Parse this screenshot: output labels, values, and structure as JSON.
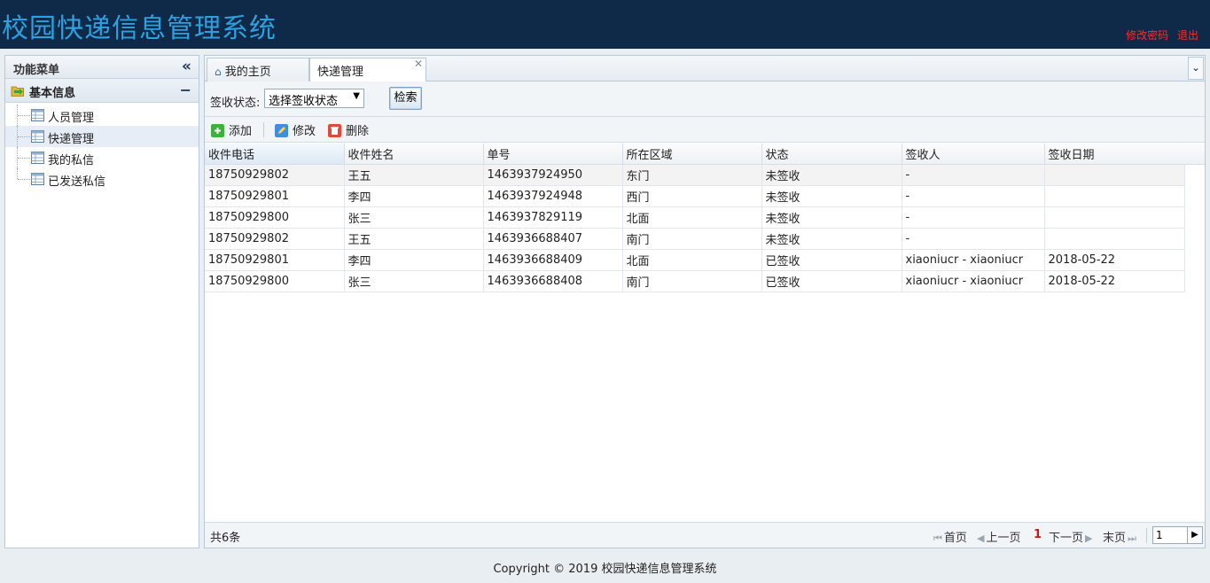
{
  "header": {
    "title": "校园快递信息管理系统",
    "change_password": "修改密码",
    "logout": "退出"
  },
  "sidebar": {
    "title": "功能菜单",
    "group": "基本信息",
    "items": [
      {
        "label": "人员管理"
      },
      {
        "label": "快递管理"
      },
      {
        "label": "我的私信"
      },
      {
        "label": "已发送私信"
      }
    ]
  },
  "tabs": [
    {
      "label": "我的主页"
    },
    {
      "label": "快递管理"
    }
  ],
  "search": {
    "label": "签收状态:",
    "select_value": "选择签收状态",
    "button": "检索"
  },
  "toolbar": {
    "add": "添加",
    "edit": "修改",
    "delete": "删除"
  },
  "table": {
    "columns": [
      "收件电话",
      "收件姓名",
      "单号",
      "所在区域",
      "状态",
      "签收人",
      "签收日期"
    ],
    "rows": [
      [
        "18750929802",
        "王五",
        "1463937924950",
        "东门",
        "未签收",
        "-",
        ""
      ],
      [
        "18750929801",
        "李四",
        "1463937924948",
        "西门",
        "未签收",
        "-",
        ""
      ],
      [
        "18750929800",
        "张三",
        "1463937829119",
        "北面",
        "未签收",
        "-",
        ""
      ],
      [
        "18750929802",
        "王五",
        "1463936688407",
        "南门",
        "未签收",
        "-",
        ""
      ],
      [
        "18750929801",
        "李四",
        "1463936688409",
        "北面",
        "已签收",
        "xiaoniucr - xiaoniucr",
        "2018-05-22"
      ],
      [
        "18750929800",
        "张三",
        "1463936688408",
        "南门",
        "已签收",
        "xiaoniucr - xiaoniucr",
        "2018-05-22"
      ]
    ]
  },
  "pager": {
    "total": "共6条",
    "first": "首页",
    "prev": "上一页",
    "current": "1",
    "next": "下一页",
    "last": "末页",
    "page_input": "1"
  },
  "footer": "Copyright © 2019 校园快递信息管理系统",
  "colors": {
    "header_bg": "#0f2a48",
    "title": "#2ea0df",
    "link_red": "#ff2a2a"
  }
}
